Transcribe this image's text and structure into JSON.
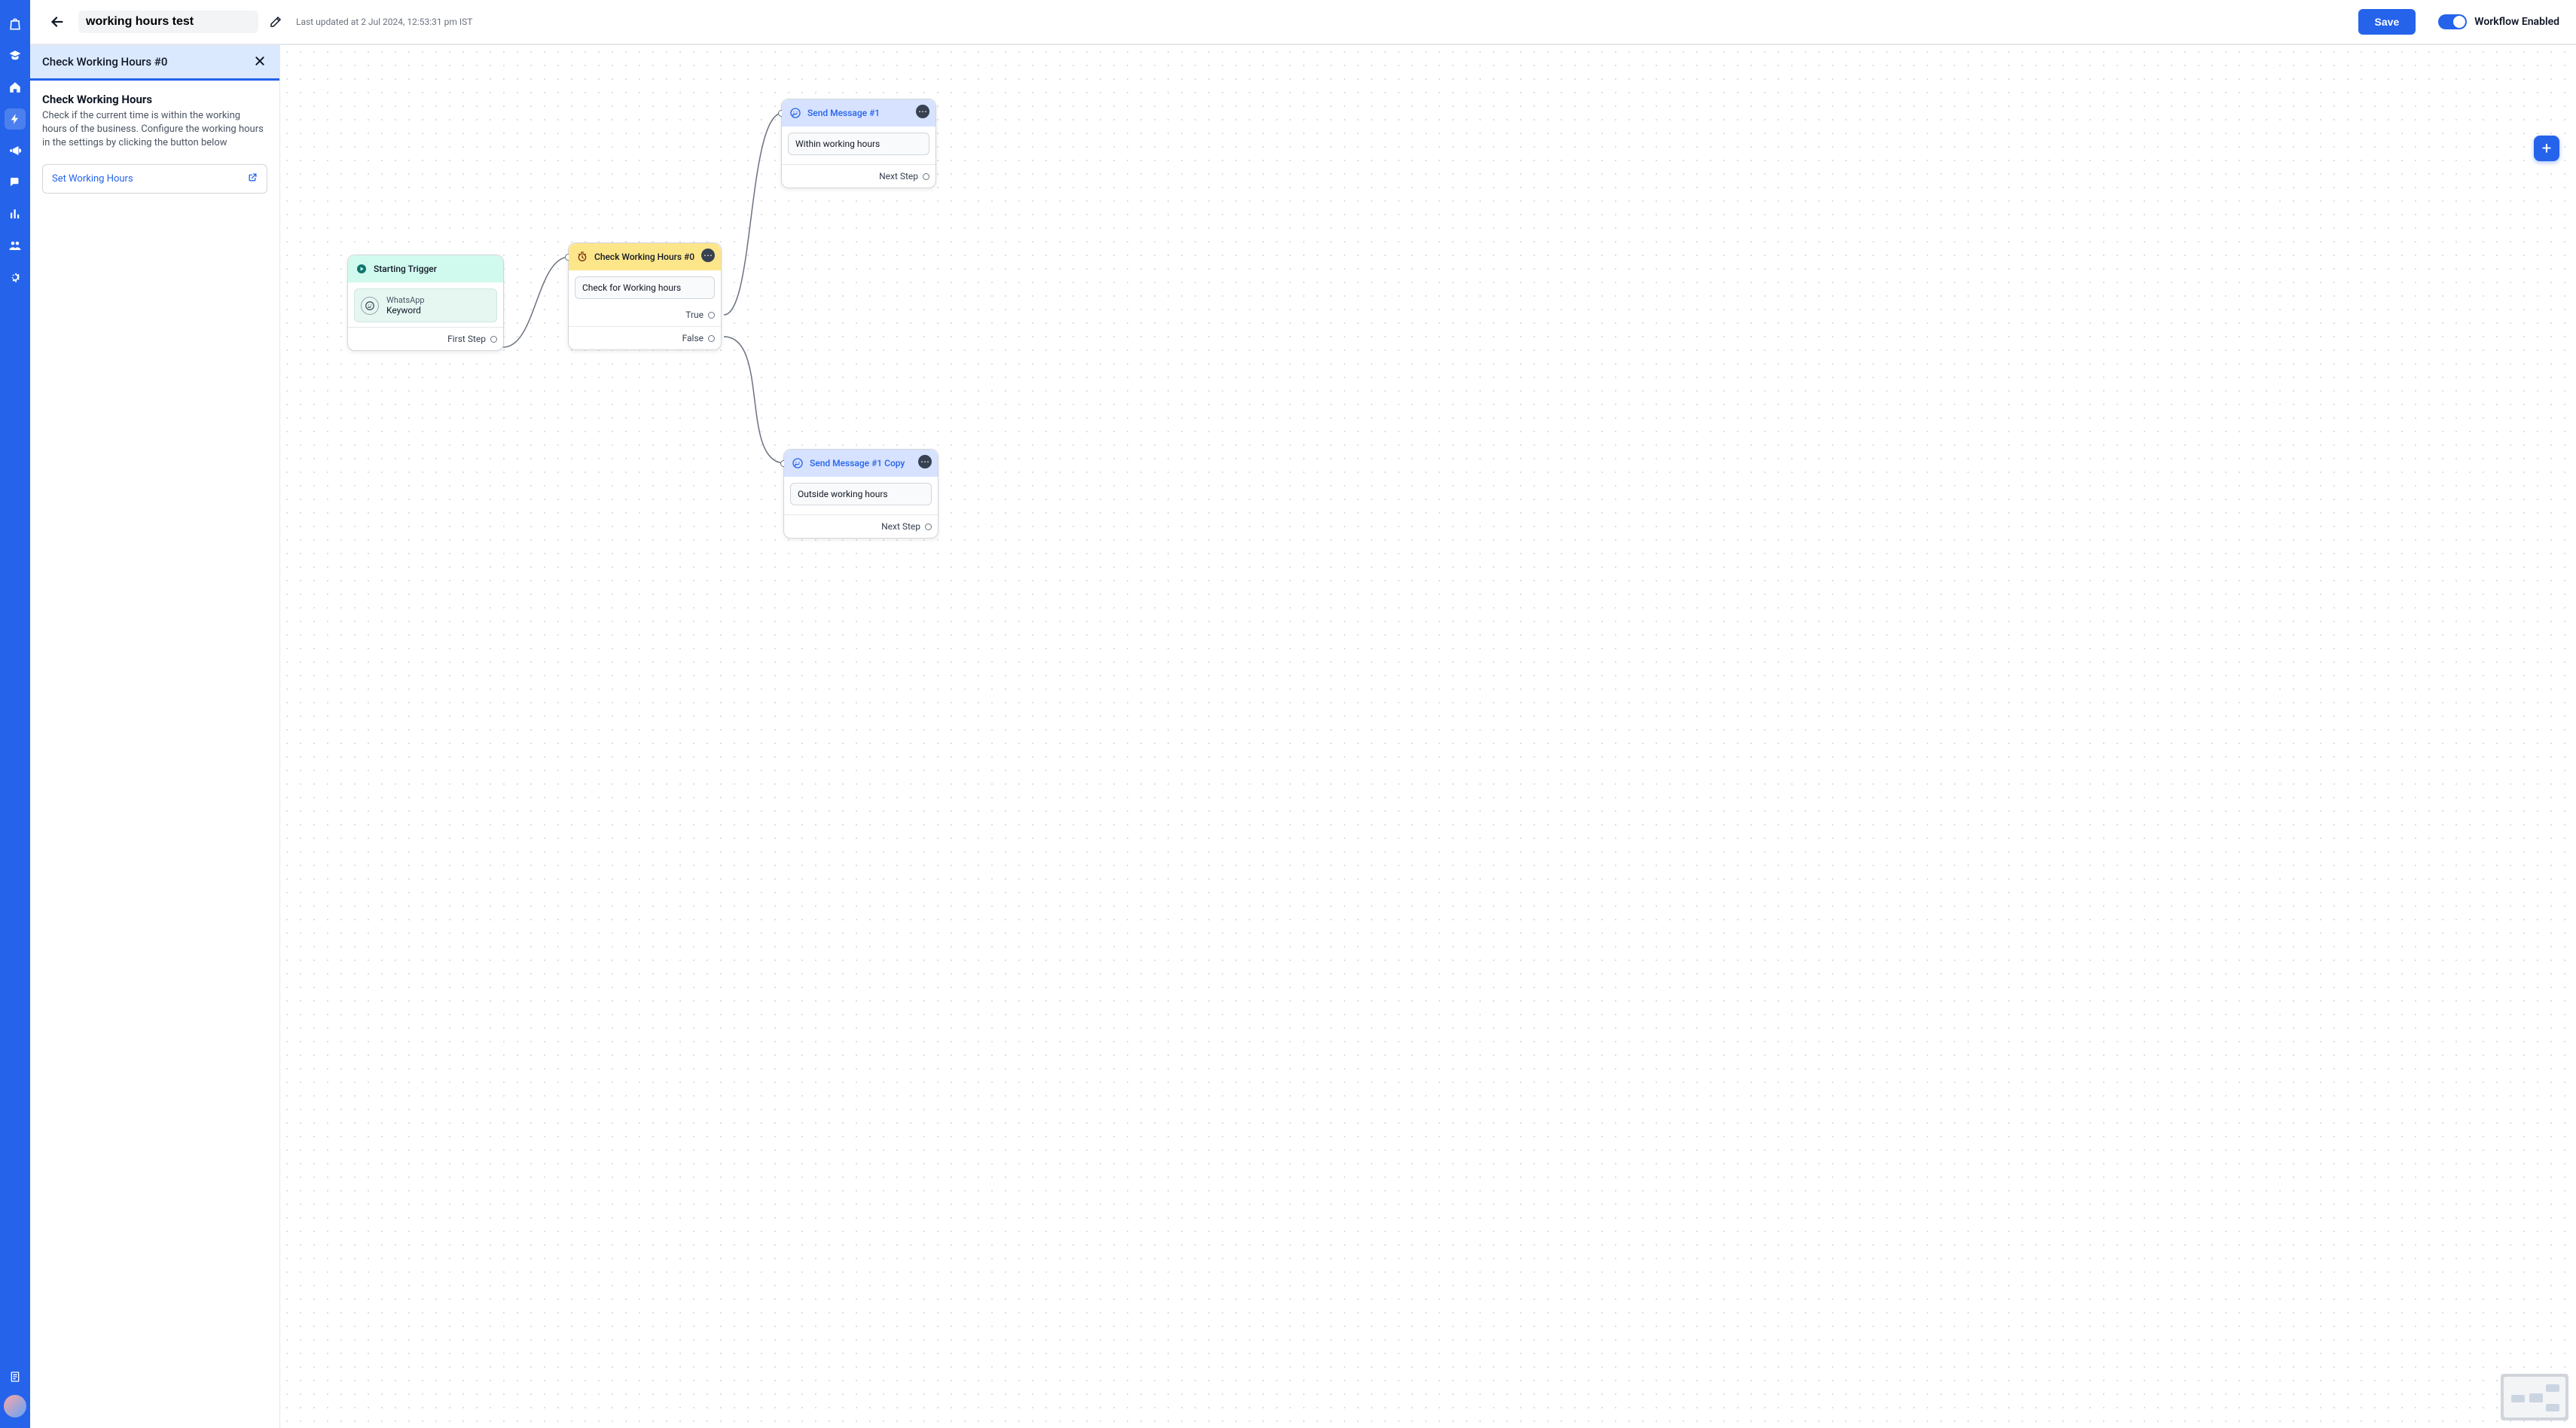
{
  "nav": {
    "items": [
      {
        "name": "bag-icon"
      },
      {
        "name": "grad-cap-icon"
      },
      {
        "name": "home-icon"
      },
      {
        "name": "bolt-icon",
        "active": true
      },
      {
        "name": "megaphone-icon"
      },
      {
        "name": "chat-icon"
      },
      {
        "name": "analytics-icon"
      },
      {
        "name": "users-icon"
      },
      {
        "name": "gear-icon"
      },
      {
        "name": "doc-icon"
      }
    ]
  },
  "header": {
    "title": "working hours test",
    "updated": "Last updated at 2 Jul 2024, 12:53:31 pm IST",
    "save": "Save",
    "toggle_label": "Workflow Enabled"
  },
  "sidepanel": {
    "title": "Check Working Hours #0",
    "subtitle": "Check Working Hours",
    "description": "Check if the current time is within the working hours of the business. Configure the working hours in the settings by clicking the button below",
    "link": "Set Working Hours"
  },
  "canvas": {
    "nodes": {
      "start": {
        "title": "Starting Trigger",
        "trigger_channel": "WhatsApp",
        "trigger_type": "Keyword",
        "out": "First Step"
      },
      "check": {
        "title": "Check Working Hours #0",
        "body": "Check for Working hours",
        "out_true": "True",
        "out_false": "False"
      },
      "msg1": {
        "title": "Send Message #1",
        "body": "Within working hours",
        "out": "Next Step"
      },
      "msg2": {
        "title": "Send Message #1 Copy",
        "body": "Outside working hours",
        "out": "Next Step"
      }
    }
  }
}
